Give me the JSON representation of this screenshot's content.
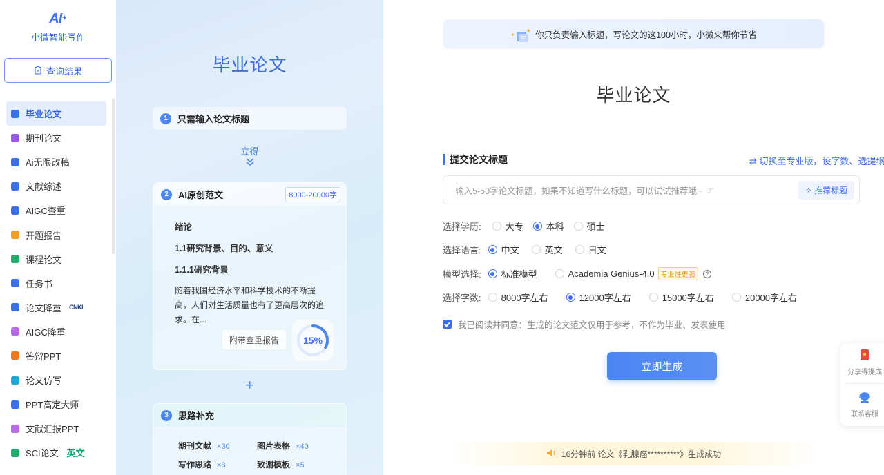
{
  "brand": {
    "mark": "AI",
    "name": "小微智能写作"
  },
  "query_button": {
    "label": "查询结果"
  },
  "sidebar": {
    "items": [
      {
        "label": "毕业论文",
        "icon": "graduation-cap-icon",
        "color": "#3d6fe8",
        "active": true
      },
      {
        "label": "期刊论文",
        "icon": "journal-icon",
        "color": "#9b59e8"
      },
      {
        "label": "Ai无限改稿",
        "icon": "quill-icon",
        "color": "#3d6fe8"
      },
      {
        "label": "文献综述",
        "icon": "bookshelf-icon",
        "color": "#3d6fe8"
      },
      {
        "label": "AIGC查重",
        "icon": "magnifier-icon",
        "color": "#3d6fe8"
      },
      {
        "label": "开题报告",
        "icon": "report-icon",
        "color": "#f0a020"
      },
      {
        "label": "课程论文",
        "icon": "book-open-icon",
        "color": "#1fae6b"
      },
      {
        "label": "任务书",
        "icon": "task-book-icon",
        "color": "#3d6fe8"
      },
      {
        "label": "论文降重",
        "icon": "reduce-icon",
        "color": "#3d6fe8",
        "badge": "CNKI"
      },
      {
        "label": "AIGC降重",
        "icon": "aigc-reduce-icon",
        "color": "#b96be8"
      },
      {
        "label": "答辩PPT",
        "icon": "ppt-icon",
        "color": "#f07a20"
      },
      {
        "label": "论文仿写",
        "icon": "imitate-icon",
        "color": "#1fa8d8"
      },
      {
        "label": "PPT高定大师",
        "icon": "ppt-master-icon",
        "color": "#3d6fe8"
      },
      {
        "label": "文献汇报PPT",
        "icon": "literature-ppt-icon",
        "color": "#b96be8"
      },
      {
        "label": "SCI论文",
        "icon": "sci-icon",
        "color": "#1fae6b",
        "badge_en": "英文"
      }
    ]
  },
  "promo": {
    "title": "毕业论文",
    "step1": {
      "num": "1",
      "label": "只需输入论文标题"
    },
    "arrow_text": "立得",
    "step2": {
      "num": "2",
      "label": "AI原创范文",
      "word_badge": "8000-20000字",
      "h1": "绪论",
      "h2": "1.1研究背景、目的、意义",
      "h3": "1.1.1研究背景",
      "para": "随着我国经济水平和科学技术的不断提高，人们对生活质量也有了更高层次的追求。在...",
      "report_tag": "附带查重报告",
      "similarity_label": "15%",
      "similarity": 0.15
    },
    "plus": "+",
    "step3": {
      "num": "3",
      "label": "思路补充",
      "items": [
        {
          "label": "期刊文献",
          "count": "×30"
        },
        {
          "label": "图片表格",
          "count": "×40"
        },
        {
          "label": "写作思路",
          "count": "×3"
        },
        {
          "label": "致谢模板",
          "count": "×5"
        }
      ]
    }
  },
  "main": {
    "slogan": "你只负责输入标题，写论文的这100小时，小微来帮你节省",
    "title": "毕业论文",
    "section_title": "提交论文标题",
    "switch_link": "⇄ 切换至专业版，设字数、选提纲",
    "input_placeholder": "输入5-50字论文标题，如果不知道写什么标题，可以试试推荐哦~",
    "recommend_label": "推荐标题",
    "education": {
      "label": "选择学历:",
      "options": [
        "大专",
        "本科",
        "硕士"
      ],
      "selected": 1
    },
    "language": {
      "label": "选择语言:",
      "options": [
        "中文",
        "英文",
        "日文"
      ],
      "selected": 0
    },
    "model": {
      "label": "模型选择:",
      "options": [
        "标准模型",
        "Academia Genius-4.0"
      ],
      "selected": 0,
      "pro_tag": "专业性更强"
    },
    "words": {
      "label": "选择字数:",
      "options": [
        "8000字左右",
        "12000字左右",
        "15000字左右",
        "20000字左右"
      ],
      "selected": 1
    },
    "agreement": "我已阅读并同意：生成的论文范文仅用于参考，不作为毕业、发表使用",
    "generate_label": "立即生成",
    "notice": "16分钟前 论文《乳腺癌**********》生成成功"
  },
  "float_panel": {
    "share_label": "分享得提成",
    "service_label": "联系客服"
  },
  "colors": {
    "accent": "#3d6fe8",
    "pro_tag": "#e49b1c"
  }
}
